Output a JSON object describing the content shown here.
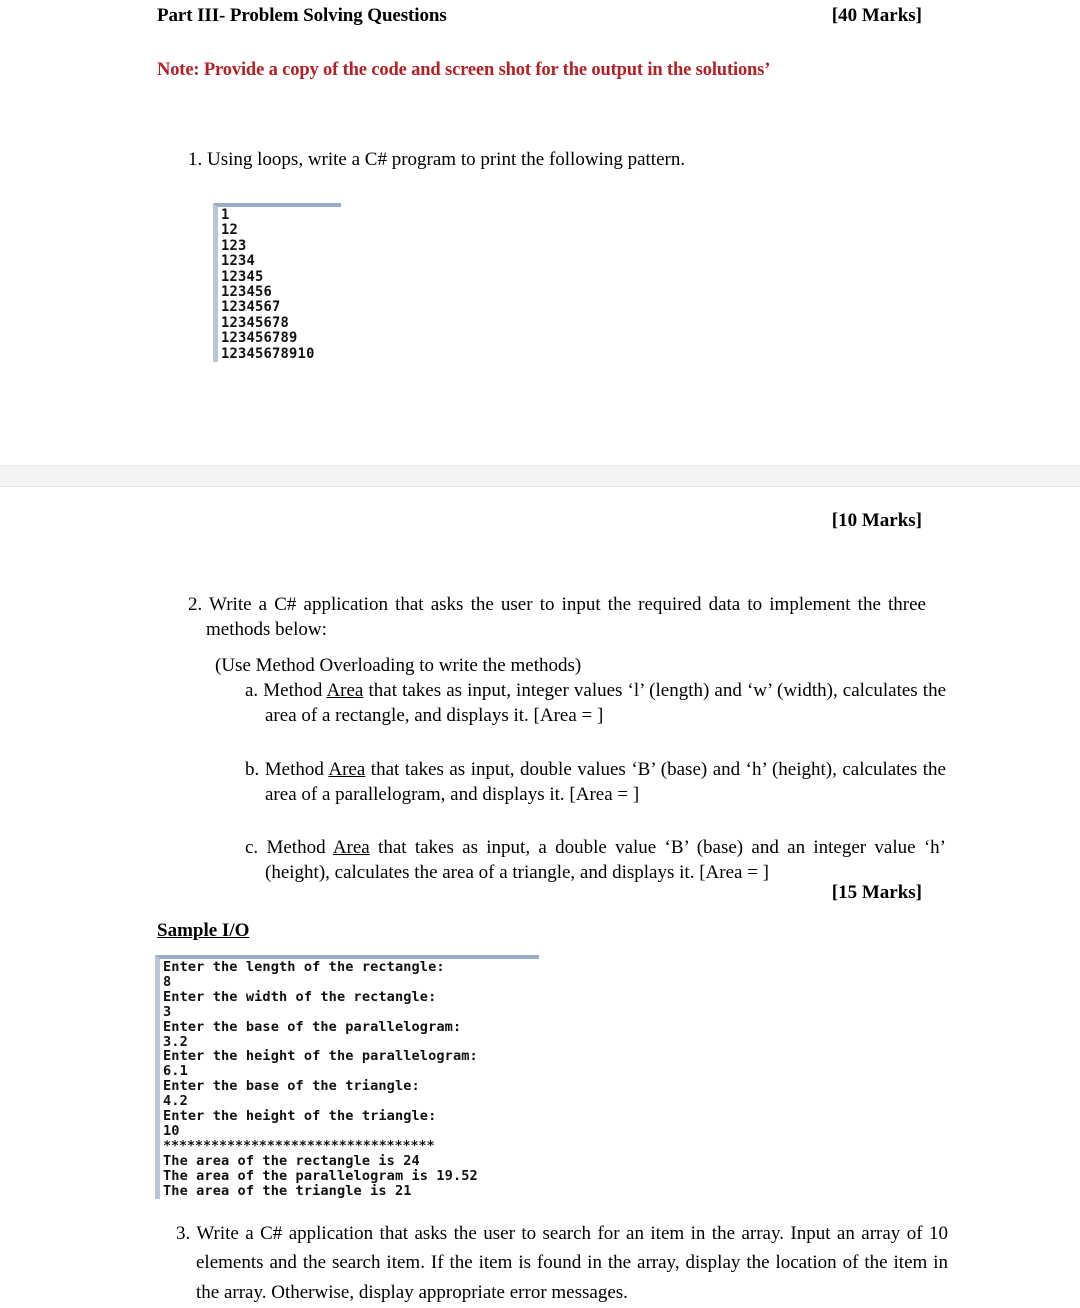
{
  "header": {
    "title": "Part III- Problem Solving Questions",
    "marks": "[40 Marks]",
    "note": "Note: Provide a copy of the code and screen shot for the output in the solutions’",
    "note_color": "#B42025"
  },
  "questions": {
    "q1": "1. Using loops, write a C# program to print the following pattern.",
    "q1_marks": "[10 Marks]",
    "q2": "2. Write a C# application that asks the user to input the required data to implement the three methods below:",
    "q2_overloading_note": "(Use Method Overloading to write the methods)",
    "q2_marks": "[15 Marks]",
    "q3": "3. Write a C# application that asks the user to search for an item in the array. Input an array of 10 elements and the search item. If the item is found in the array, display the location of the item in the array. Otherwise, display appropriate error messages."
  },
  "sub_items": {
    "a": {
      "prefix": "a. Method ",
      "underlined": "Area",
      "rest": " that takes as input, integer values ‘l’ (length) and ‘w’ (width), calculates the area of a rectangle, and displays it. [Area = ]"
    },
    "b": {
      "prefix": "b. Method ",
      "underlined": "Area",
      "rest": " that takes as input, double values ‘B’ (base) and ‘h’ (height), calculates the area of a parallelogram, and displays it. [Area = ]"
    },
    "c": {
      "prefix": "c. Method ",
      "underlined": "Area",
      "rest": " that takes as input, a double value ‘B’ (base) and an integer value ‘h’ (height), calculates the area of a triangle, and displays it. [Area = ]"
    }
  },
  "sample_io": {
    "heading": "Sample I/O"
  },
  "console_pattern": {
    "lines": [
      "1",
      "12",
      "123",
      "1234",
      "12345",
      "123456",
      "1234567",
      "12345678",
      "123456789",
      "12345678910"
    ]
  },
  "console_sample": {
    "lines": [
      "Enter the length of the rectangle:",
      "8",
      "Enter the width of the rectangle:",
      "3",
      "Enter the base of the parallelogram:",
      "3.2",
      "Enter the height of the parallelogram:",
      "6.1",
      "Enter the base of the triangle:",
      "4.2",
      "Enter the height of the triangle:",
      "10",
      "**********************************",
      "The area of the rectangle is 24",
      "The area of the parallelogram is 19.52",
      "The area of the triangle is 21"
    ]
  },
  "colors": {
    "console_border_top": "#9aadc4",
    "console_border_left": "#b9c6d6",
    "page_separator": "#f4f4f4"
  }
}
